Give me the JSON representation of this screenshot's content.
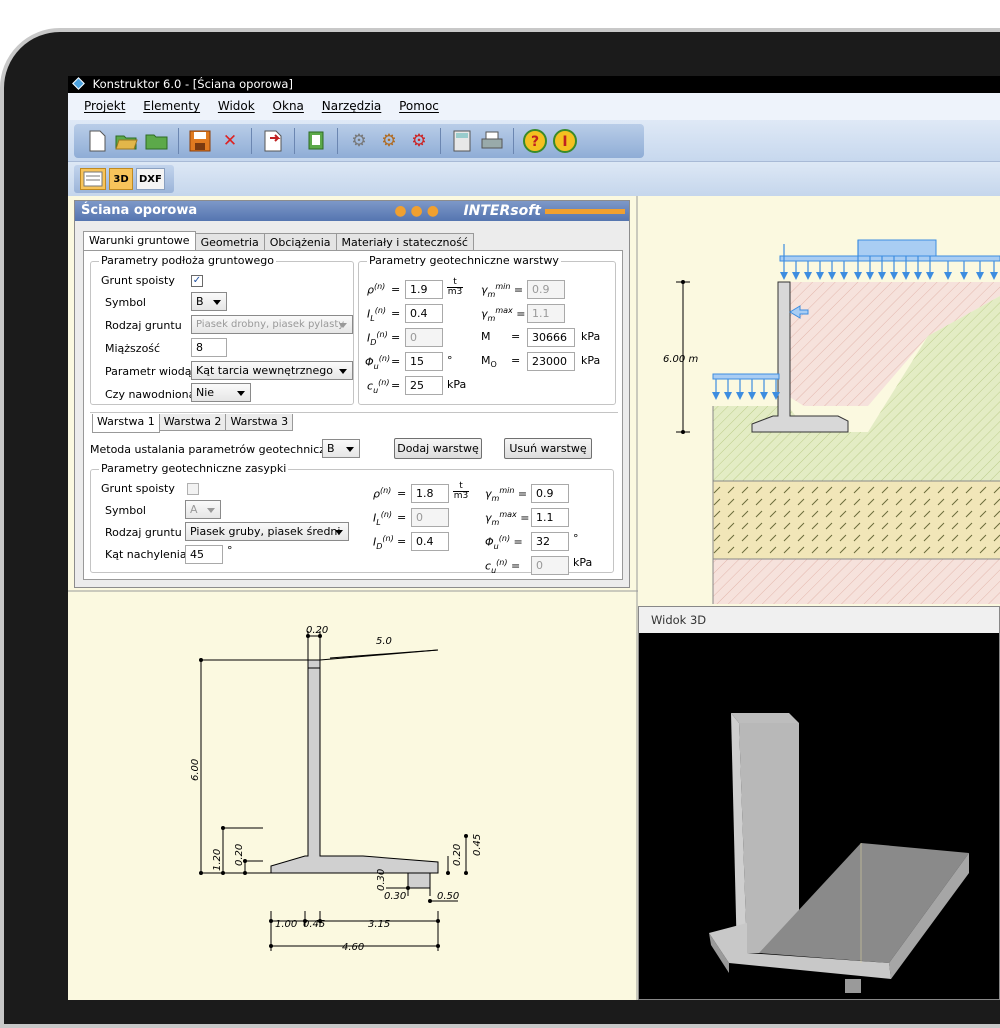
{
  "window": {
    "title": "Konstruktor 6.0 - [Ściana oporowa]"
  },
  "menu": [
    "Projekt",
    "Elementy",
    "Widok",
    "Okna",
    "Narzędzia",
    "Pomoc"
  ],
  "toolbar": {
    "icons": [
      "new-file-icon",
      "open-folder-icon",
      "folder-icon",
      "save-icon",
      "delete-icon",
      "export-icon",
      "print-preview-icon",
      "gear-settings-icon",
      "gear-add-icon",
      "gear-delete-icon",
      "calculator-icon",
      "printer-icon",
      "help-icon",
      "info-icon"
    ],
    "secondary": [
      "2D",
      "3D",
      "DXF"
    ]
  },
  "panel": {
    "title": "Ściana oporowa",
    "brand": "INTERsoft",
    "tabs": [
      "Warunki gruntowe",
      "Geometria",
      "Obciążenia",
      "Materiały i stateczność"
    ],
    "subsoil": {
      "title": "Parametry podłoża gruntowego",
      "cohesive_label": "Grunt spoisty",
      "symbol_label": "Symbol",
      "symbol_value": "B",
      "soil_type_label": "Rodzaj gruntu",
      "soil_type_value": "Piasek drobny, piasek pylasty",
      "thickness_label": "Miąższość",
      "thickness_value": "8",
      "leading_param_label": "Parametr wiodący",
      "leading_param_value": "Kąt tarcia wewnętrznego",
      "watered_label": "Czy nawodniona",
      "watered_value": "Nie"
    },
    "layer_params": {
      "title": "Parametry geotechniczne warstwy",
      "rho": "1.9",
      "IL": "0.4",
      "ID": "0",
      "phi": "15",
      "cu": "25",
      "gmin": "0.9",
      "gmax": "1.1",
      "M": "30666",
      "M0": "23000",
      "unit_tm3_num": "t",
      "unit_tm3_den": "m3",
      "unit_deg": "°",
      "unit_kpa": "kPa",
      "eq": "="
    },
    "layer_tabs": [
      "Warstwa 1",
      "Warstwa 2",
      "Warstwa 3"
    ],
    "method_label": "Metoda ustalania parametrów geotechnicznych",
    "method_value": "B",
    "add_layer": "Dodaj warstwę",
    "remove_layer": "Usuń warstwę",
    "backfill": {
      "title": "Parametry geotechniczne zasypki",
      "cohesive_label": "Grunt spoisty",
      "symbol_label": "Symbol",
      "symbol_value": "A",
      "soil_type_label": "Rodzaj gruntu",
      "soil_type_value": "Piasek gruby, piasek średni",
      "slope_label": "Kąt nachylenia",
      "slope_value": "45",
      "rho": "1.8",
      "IL": "0",
      "ID": "0.4",
      "gmin": "0.9",
      "gmax": "1.1",
      "phi": "32",
      "cu": "0"
    }
  },
  "section_view": {
    "height_label": "6.00 m"
  },
  "dimensions": {
    "top_width": "0.20",
    "slope": "5.0",
    "height": "6.00",
    "h120": "1.20",
    "h020a": "0.20",
    "h020b": "0.20",
    "h045": "0.45",
    "key_depth": "0.30",
    "key_width": "0.30",
    "key_offset": "0.50",
    "toe": "1.00",
    "wall": "0.45",
    "heel": "3.15",
    "total": "4.60"
  },
  "view3d": {
    "title": "Widok 3D"
  },
  "colors": {
    "accent": "#f0a030",
    "panel_head": "#5a78b2",
    "background": "#fbf9e0",
    "load_blue": "#3d8de0"
  }
}
